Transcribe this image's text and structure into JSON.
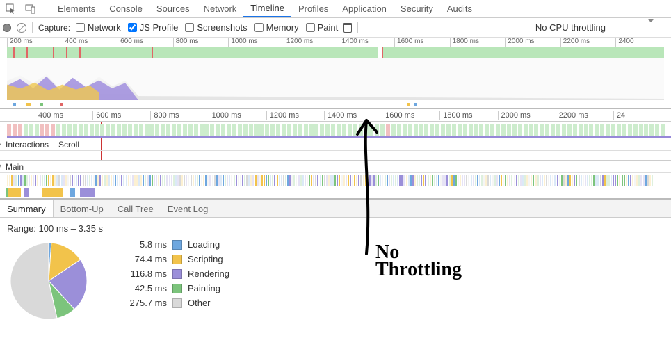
{
  "tabs": [
    "Elements",
    "Console",
    "Sources",
    "Network",
    "Timeline",
    "Profiles",
    "Application",
    "Security",
    "Audits"
  ],
  "active_tab": "Timeline",
  "capture": {
    "label": "Capture:",
    "opts": [
      {
        "label": "Network",
        "checked": false
      },
      {
        "label": "JS Profile",
        "checked": true
      },
      {
        "label": "Screenshots",
        "checked": false
      },
      {
        "label": "Memory",
        "checked": false
      },
      {
        "label": "Paint",
        "checked": false
      }
    ],
    "throttle": "No CPU throttling"
  },
  "overview_ticks": [
    "200 ms",
    "400 ms",
    "600 ms",
    "800 ms",
    "1000 ms",
    "1200 ms",
    "1400 ms",
    "1600 ms",
    "1800 ms",
    "2000 ms",
    "2200 ms",
    "2400"
  ],
  "detail_ticks": [
    "400 ms",
    "600 ms",
    "800 ms",
    "1000 ms",
    "1200 ms",
    "1400 ms",
    "1600 ms",
    "1800 ms",
    "2000 ms",
    "2200 ms",
    "24"
  ],
  "rows": {
    "interactions": "Interactions",
    "scroll": "Scroll",
    "main": "Main"
  },
  "summary_tabs": [
    "Summary",
    "Bottom-Up",
    "Call Tree",
    "Event Log"
  ],
  "active_summary_tab": "Summary",
  "range": "Range: 100 ms – 3.35 s",
  "colors": {
    "loading": "#6ea7df",
    "scripting": "#f2c34b",
    "rendering": "#9b8fd9",
    "painting": "#7cc47c",
    "other": "#d9d9d9",
    "frame_green": "#cdeccd",
    "frame_red": "#f1c0c0"
  },
  "chart_data": {
    "type": "pie",
    "title": "",
    "series": [
      {
        "name": "Loading",
        "value": 5.8,
        "unit": "ms"
      },
      {
        "name": "Scripting",
        "value": 74.4,
        "unit": "ms"
      },
      {
        "name": "Rendering",
        "value": 116.8,
        "unit": "ms"
      },
      {
        "name": "Painting",
        "value": 42.5,
        "unit": "ms"
      },
      {
        "name": "Other",
        "value": 275.7,
        "unit": "ms"
      }
    ]
  },
  "annotation_text": "No\nThrottling"
}
